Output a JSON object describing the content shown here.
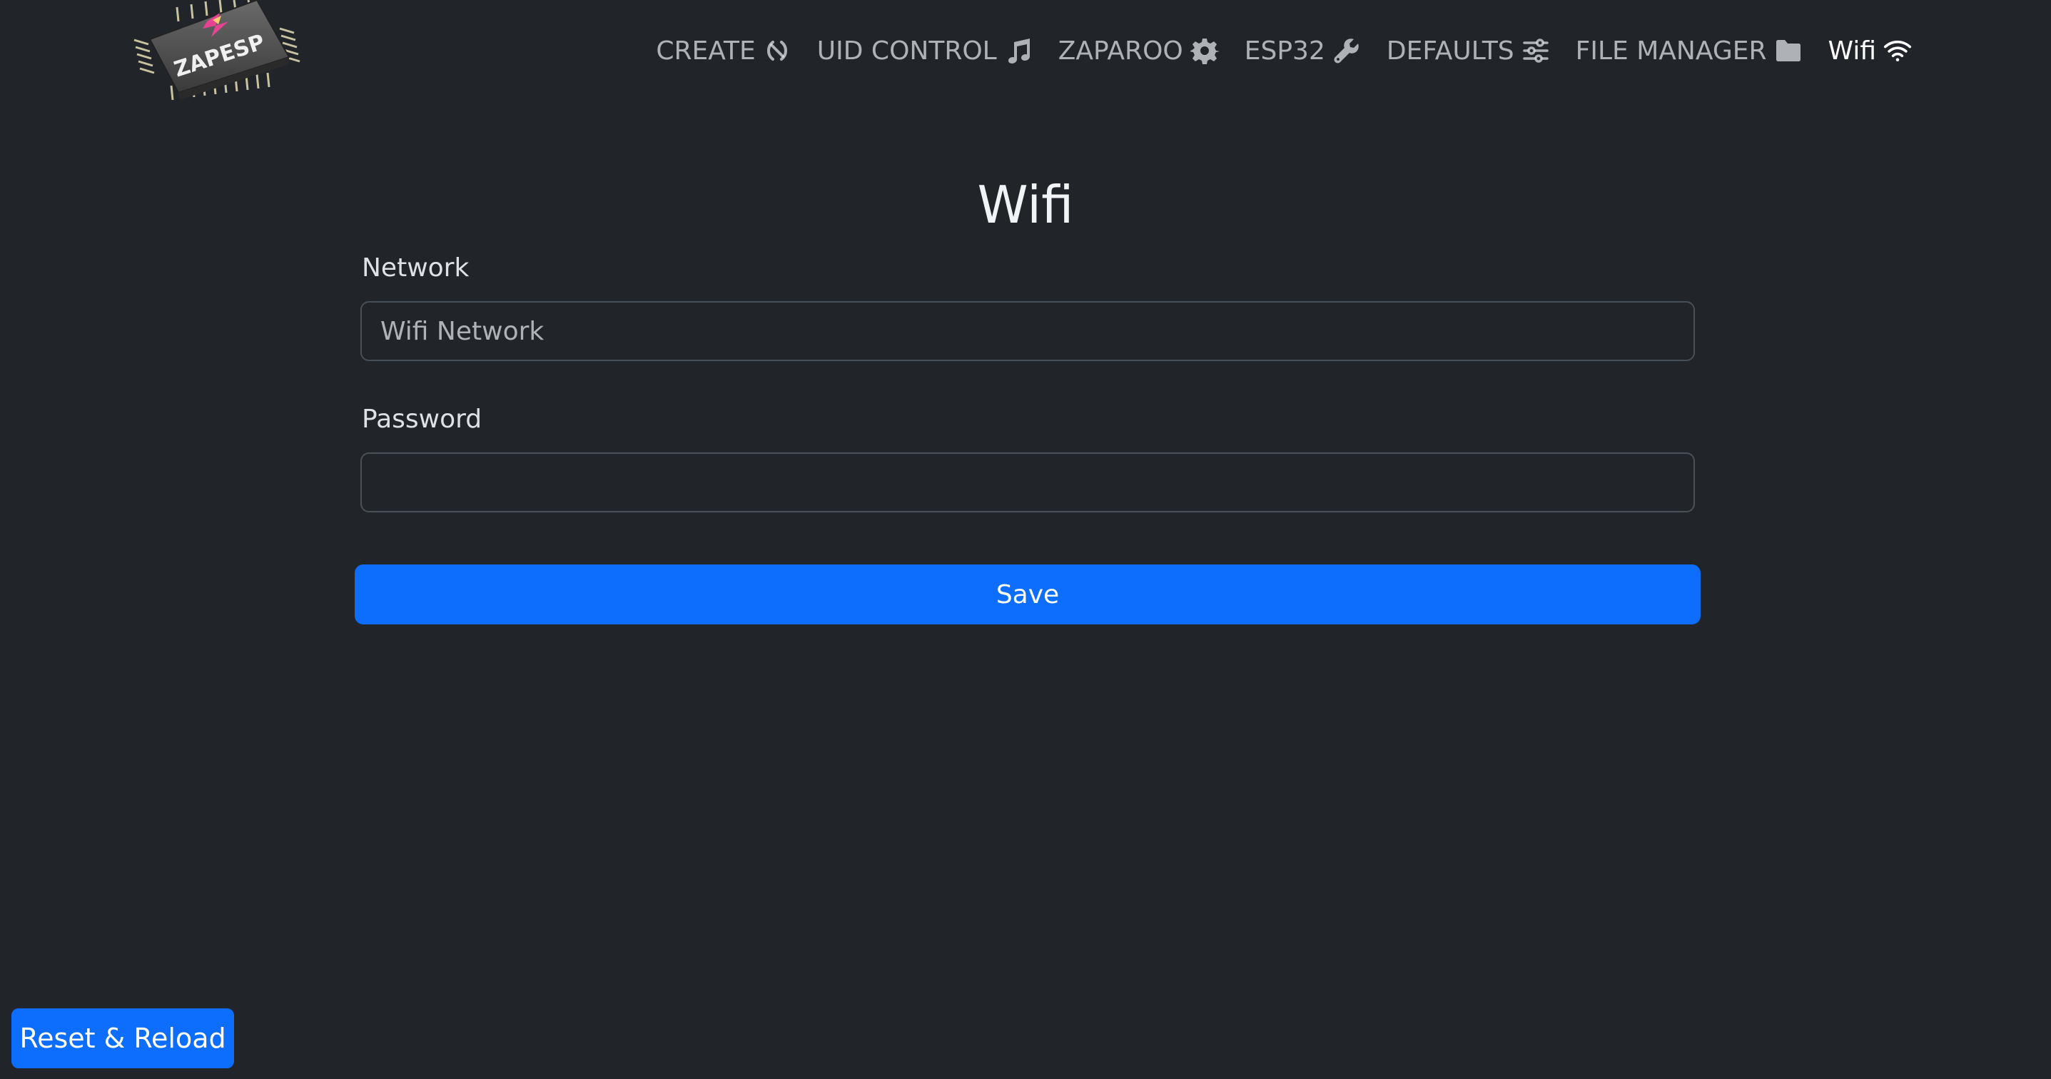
{
  "logo": {
    "text": "ZAPESP"
  },
  "nav": {
    "items": [
      {
        "label": "CREATE",
        "icon": "nfc-icon"
      },
      {
        "label": "UID CONTROL",
        "icon": "music-note-icon"
      },
      {
        "label": "ZAPAROO",
        "icon": "gear-icon"
      },
      {
        "label": "ESP32",
        "icon": "wrench-icon"
      },
      {
        "label": "DEFAULTS",
        "icon": "sliders-icon"
      },
      {
        "label": "FILE MANAGER",
        "icon": "folder-icon"
      },
      {
        "label": "Wifi",
        "icon": "wifi-icon",
        "active": true
      }
    ]
  },
  "page": {
    "title": "Wifi"
  },
  "form": {
    "network_label": "Network",
    "network_placeholder": "Wifi Network",
    "network_value": "",
    "password_label": "Password",
    "password_value": "",
    "save_label": "Save"
  },
  "footer": {
    "reset_label": "Reset & Reload"
  },
  "colors": {
    "background": "#212529",
    "primary": "#0d6efd",
    "border": "#495057"
  }
}
